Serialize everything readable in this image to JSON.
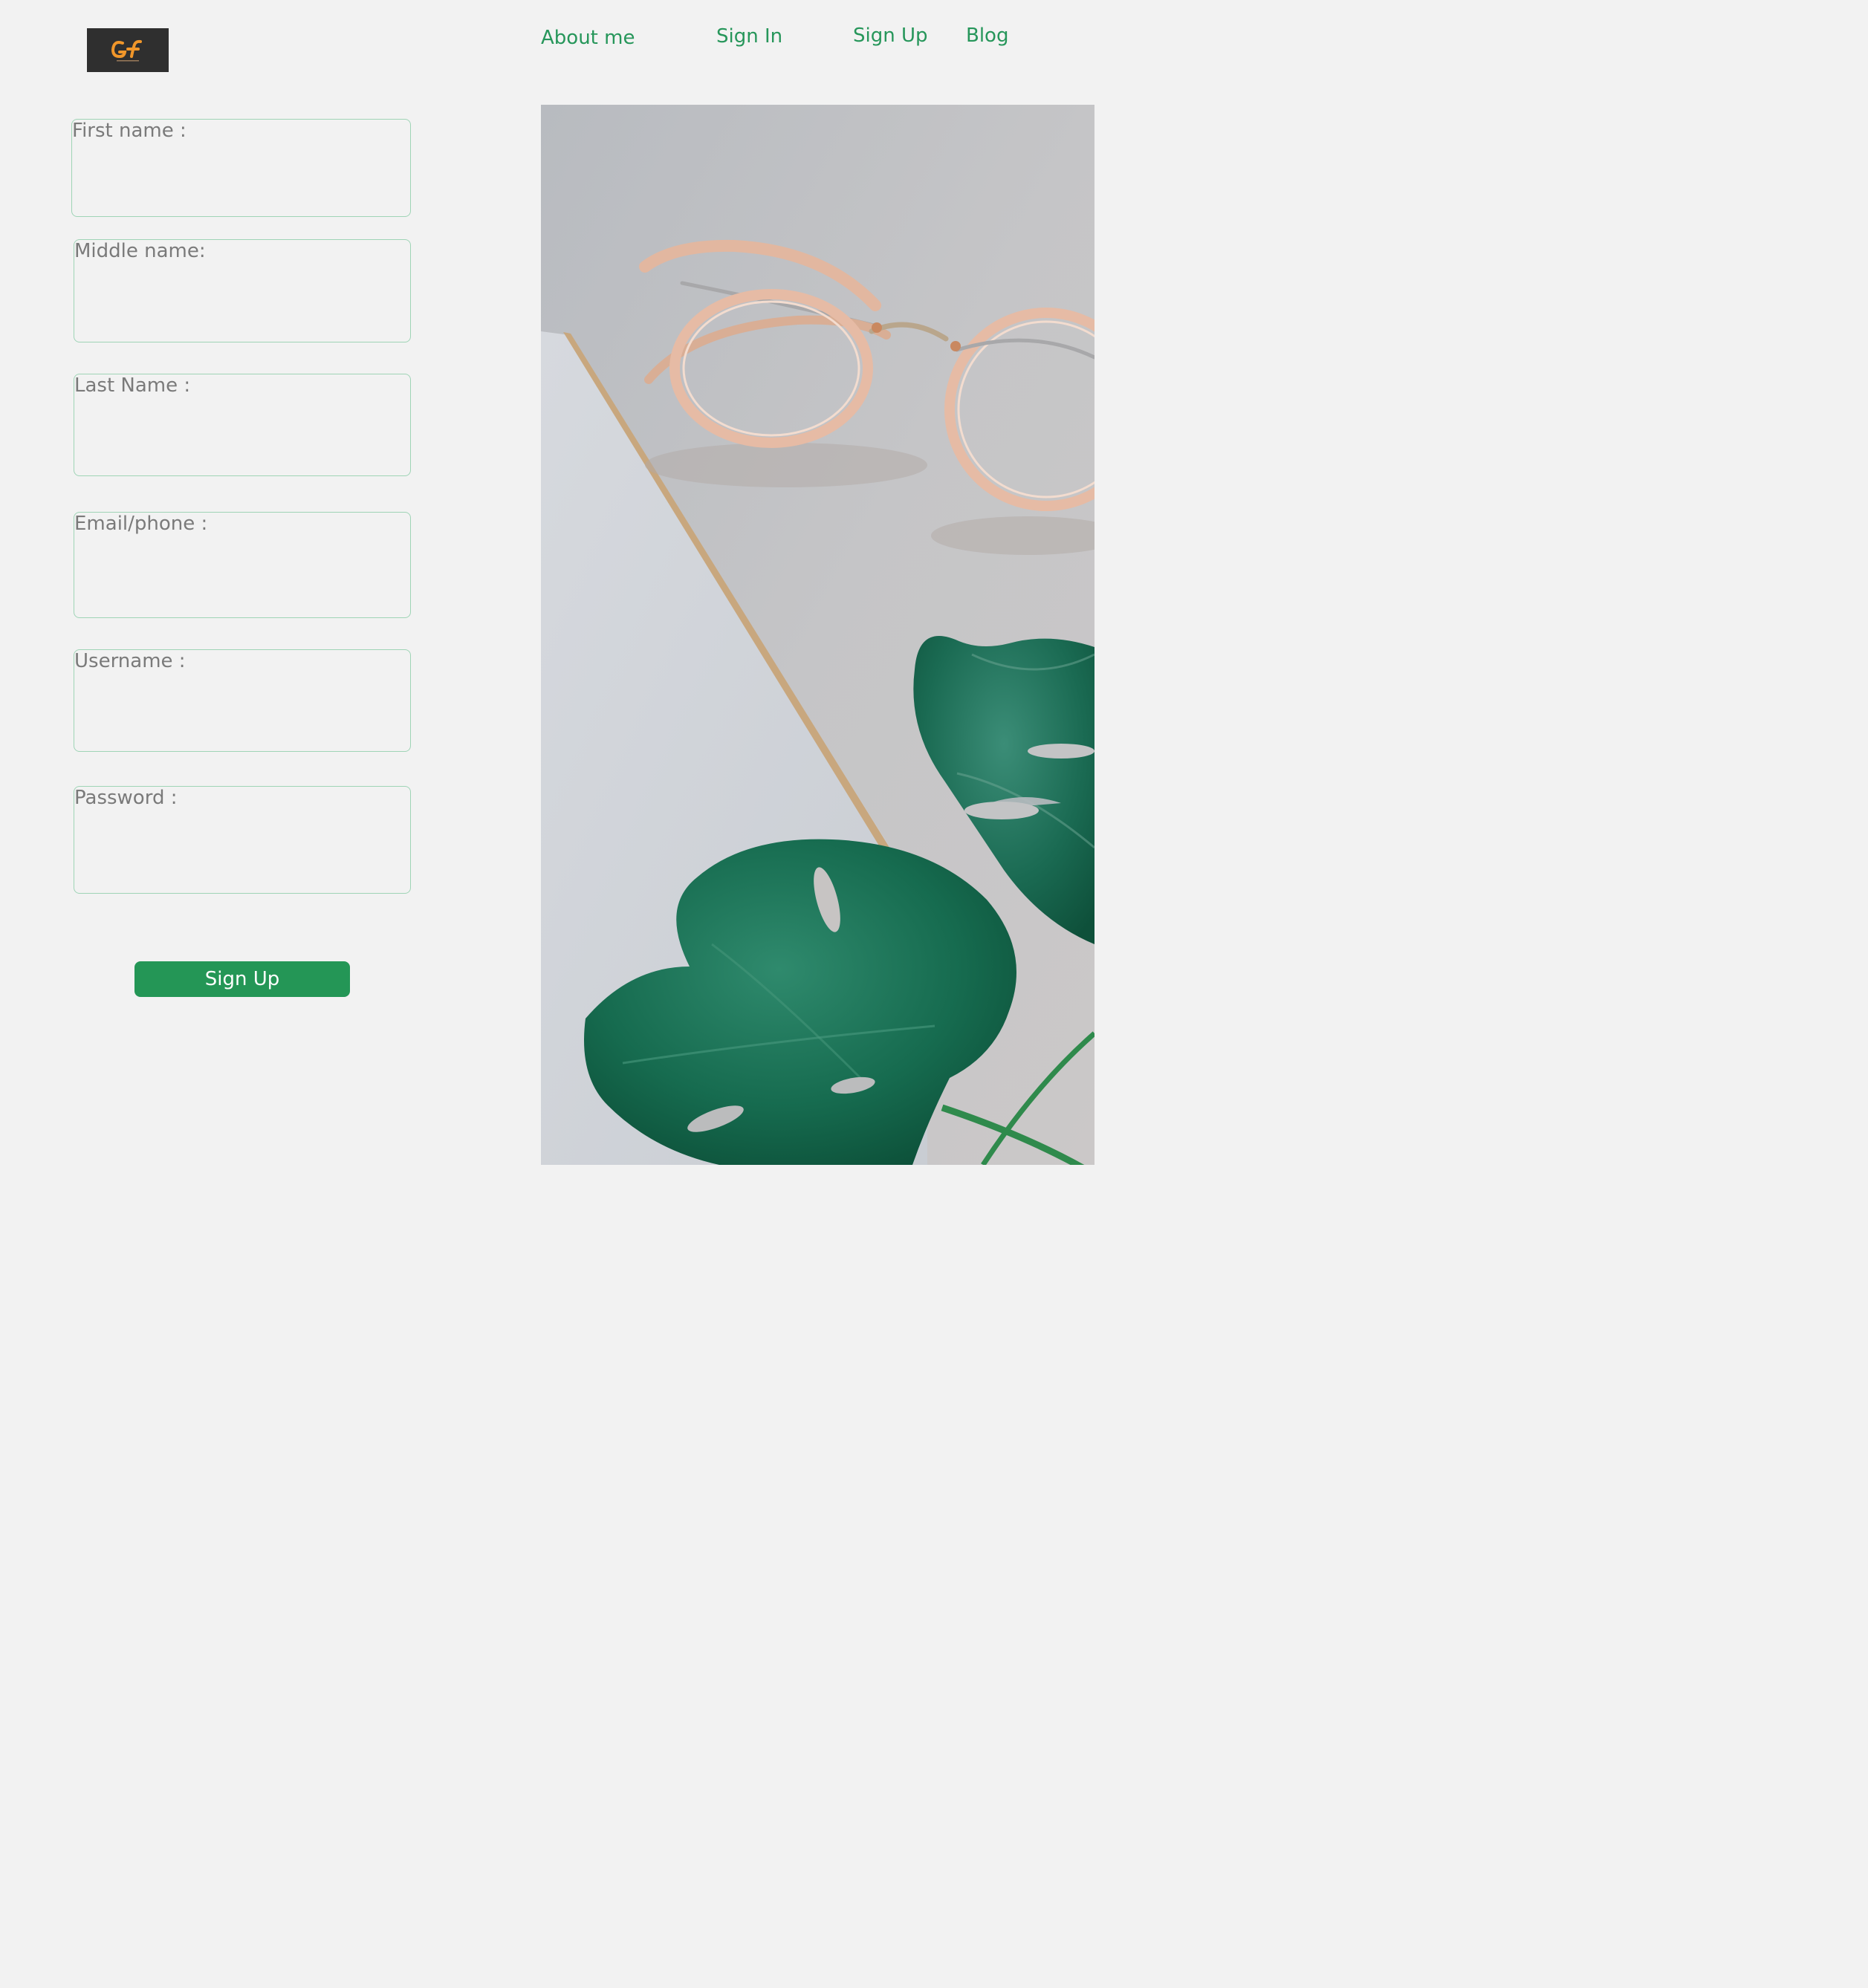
{
  "brand": {
    "logo_text": "GF",
    "logo_bg": "#2f2f2f",
    "logo_accent": "#f0962a"
  },
  "nav": {
    "about": "About me",
    "sign_in": "Sign In",
    "sign_up": "Sign Up",
    "blog": "Blog"
  },
  "form": {
    "fields": [
      {
        "label": "First name :",
        "value": ""
      },
      {
        "label": "Middle name:",
        "value": ""
      },
      {
        "label": "Last Name :",
        "value": ""
      },
      {
        "label": "Email/phone :",
        "value": ""
      },
      {
        "label": "Username :",
        "value": ""
      },
      {
        "label": "Password :",
        "value": ""
      }
    ],
    "submit_label": "Sign Up"
  },
  "hero": {
    "icon": "glasses-and-monstera-leaves-photo"
  },
  "colors": {
    "accent": "#26965a",
    "button": "#249656",
    "field_border": "#9fd4b6",
    "label": "#7a7a7a",
    "background": "#f2f2f2"
  }
}
